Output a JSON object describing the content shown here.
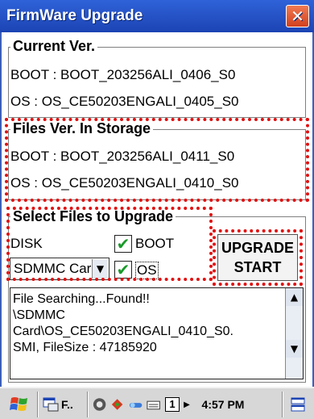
{
  "window": {
    "title": "FirmWare Upgrade",
    "close_label": "✕"
  },
  "current": {
    "label": "Current Ver.",
    "boot": "BOOT : BOOT_203256ALI_0406_S0",
    "os": "OS    : OS_CE50203ENGALI_0405_S0"
  },
  "storage": {
    "label": "Files Ver. In Storage",
    "boot": "BOOT : BOOT_203256ALI_0411_S0",
    "os": "OS    : OS_CE50203ENGALI_0410_S0"
  },
  "select": {
    "label": "Select Files to Upgrade",
    "disk_label": "DISK",
    "disk_value": "SDMMC Car",
    "boot_label": "BOOT",
    "boot_checked": true,
    "os_label": "OS",
    "os_checked": true
  },
  "upgrade_button": {
    "line1": "UPGRADE",
    "line2": "START"
  },
  "log": {
    "lines": "File Searching...Found!!\n\\SDMMC\nCard\\OS_CE50203ENGALI_0410_S0.\nSMI, FileSize : 47185920"
  },
  "taskbar": {
    "app_label": "F..",
    "input_value": "1",
    "time": "4:57 PM"
  },
  "colors": {
    "title_bar": "#1c44b4",
    "highlight": "#e01010",
    "check": "#1a9a2a"
  }
}
